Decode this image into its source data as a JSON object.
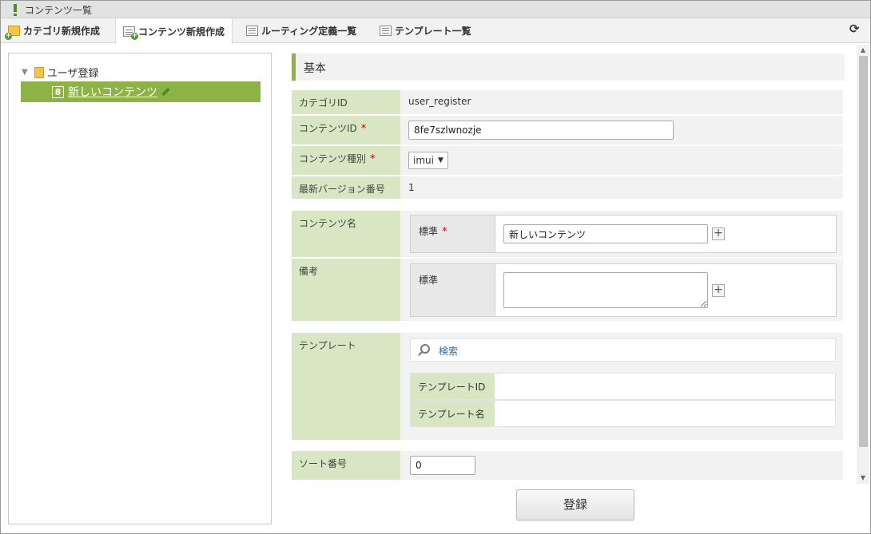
{
  "window": {
    "title": "コンテンツ一覧"
  },
  "tabs": [
    {
      "label": "カテゴリ新規作成",
      "icon": "folder-add-icon"
    },
    {
      "label": "コンテンツ新規作成",
      "icon": "document-add-icon",
      "active": true
    },
    {
      "label": "ルーティング定義一覧",
      "icon": "list-icon"
    },
    {
      "label": "テンプレート一覧",
      "icon": "list-icon"
    }
  ],
  "tree": {
    "root_label": "ユーザ登録",
    "selected": {
      "number": "8",
      "label": "新しいコンテンツ"
    }
  },
  "form": {
    "section_title": "基本",
    "category_id": {
      "label": "カテゴリID",
      "value": "user_register"
    },
    "content_id": {
      "label": "コンテンツID",
      "required": "*",
      "value": "8fe7szlwnozje"
    },
    "content_type": {
      "label": "コンテンツ種別",
      "required": "*",
      "value": "imui"
    },
    "latest_version": {
      "label": "最新バージョン番号",
      "value": "1"
    },
    "content_name": {
      "label": "コンテンツ名",
      "sub_label": "標準",
      "required": "*",
      "value": "新しいコンテンツ"
    },
    "remarks": {
      "label": "備考",
      "sub_label": "標準",
      "value": ""
    },
    "template": {
      "label": "テンプレート",
      "search_label": "検索",
      "template_id_label": "テンプレートID",
      "template_name_label": "テンプレート名"
    },
    "sort_order": {
      "label": "ソート番号",
      "value": "0"
    },
    "submit_label": "登録"
  },
  "colors": {
    "accent_green": "#8db348",
    "label_bg": "#d8e6c3",
    "link_blue": "#2a6db3",
    "required_red": "#d40000"
  }
}
